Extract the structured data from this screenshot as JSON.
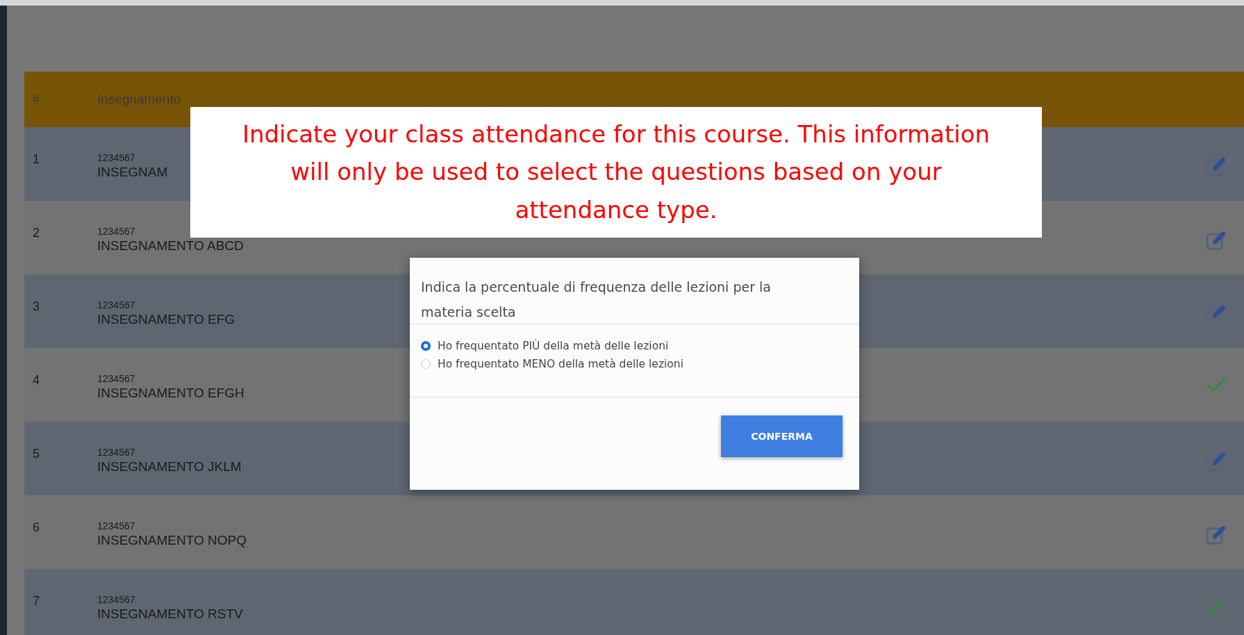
{
  "table": {
    "columns": [
      "#",
      "Insegnamento"
    ],
    "rows": [
      {
        "number": "1",
        "code": "1234567",
        "name": "INSEGNAM",
        "kind": "edit"
      },
      {
        "number": "2",
        "code": "1234567",
        "name": "INSEGNAMENTO ABCD",
        "kind": "edit"
      },
      {
        "number": "3",
        "code": "1234567",
        "name": "INSEGNAMENTO EFG",
        "kind": "edit"
      },
      {
        "number": "4",
        "code": "1234567",
        "name": "INSEGNAMENTO EFGH",
        "kind": "done"
      },
      {
        "number": "5",
        "code": "1234567",
        "name": "INSEGNAMENTO JKLM",
        "kind": "edit"
      },
      {
        "number": "6",
        "code": "1234567",
        "name": "INSEGNAMENTO NOPQ",
        "kind": "edit"
      },
      {
        "number": "7",
        "code": "1234567",
        "name": "INSEGNAMENTO RSTV",
        "kind": "done"
      }
    ]
  },
  "annotation": {
    "text": "Indicate your class attendance for this course. This information will only be used to select the questions based on your attendance type."
  },
  "modal": {
    "question": "Indica la percentuale di frequenza delle lezioni per la materia scelta",
    "options": [
      {
        "label": "Ho frequentato PIÙ della metà delle lezioni",
        "selected": true
      },
      {
        "label": "Ho frequentato MENO della metà delle lezioni",
        "selected": false
      }
    ],
    "button": "CONFERMA"
  }
}
